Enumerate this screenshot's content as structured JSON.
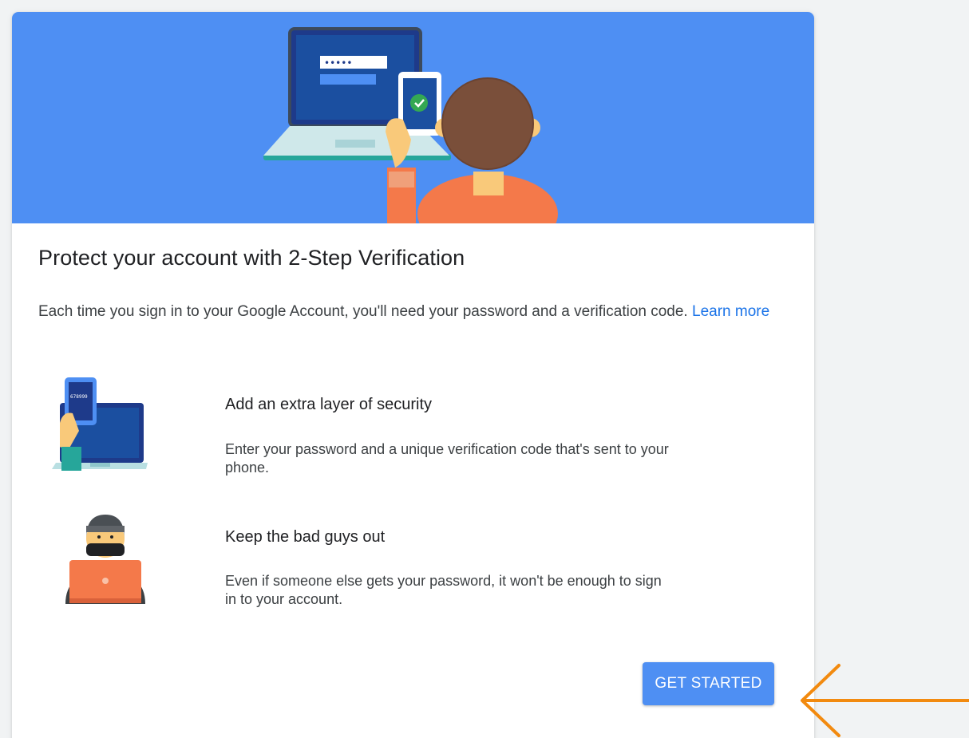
{
  "colors": {
    "hero_background": "#4e8ff3",
    "button_background": "#4e8ff3",
    "link": "#1a73e8",
    "arrow": "#f28a0f"
  },
  "card": {
    "title": "Protect your account with 2-Step Verification",
    "description": "Each time you sign in to your Google Account, you'll need your password and a verification code.",
    "learn_more_label": "Learn more",
    "features": [
      {
        "icon": "phone-laptop-illustration",
        "title": "Add an extra layer of security",
        "description": "Enter your password and a unique verification code that's sent to your phone."
      },
      {
        "icon": "hacker-illustration",
        "title": "Keep the bad guys out",
        "description": "Even if someone else gets your password, it won't be enough to sign in to your account."
      }
    ],
    "get_started_label": "GET STARTED"
  },
  "hero": {
    "password_mask": "•••••"
  },
  "feature_phone_code": "678999"
}
